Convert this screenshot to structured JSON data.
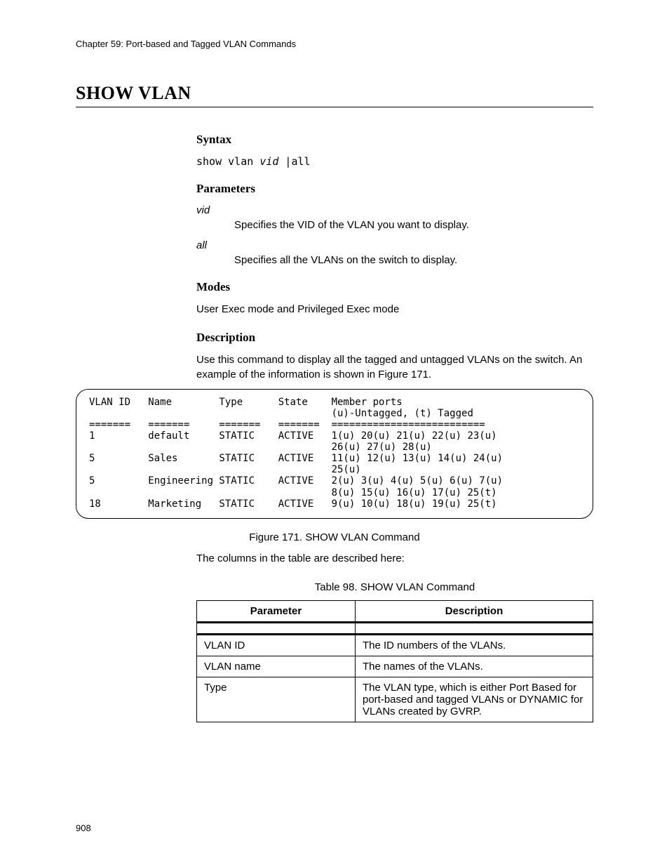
{
  "chapter_header": "Chapter 59: Port-based and Tagged VLAN Commands",
  "title": "SHOW VLAN",
  "sections": {
    "syntax": {
      "heading": "Syntax",
      "cmd_prefix": "show vlan ",
      "cmd_arg": "vid",
      "cmd_suffix": " |all"
    },
    "parameters": {
      "heading": "Parameters",
      "items": [
        {
          "term": "vid",
          "def": "Specifies the VID of the VLAN you want to display."
        },
        {
          "term": "all",
          "def": "Specifies all the VLANs on the switch to display."
        }
      ]
    },
    "modes": {
      "heading": "Modes",
      "text": "User Exec mode and Privileged Exec mode"
    },
    "description": {
      "heading": "Description",
      "text": "Use this command to display all the tagged and untagged VLANs on the switch. An example of the information is shown in Figure 171."
    }
  },
  "codebox": "VLAN ID   Name        Type      State    Member ports\n                                         (u)-Untagged, (t) Tagged\n=======   =======     =======   =======  ==========================\n1         default     STATIC    ACTIVE   1(u) 20(u) 21(u) 22(u) 23(u)\n                                         26(u) 27(u) 28(u)\n5         Sales       STATIC    ACTIVE   11(u) 12(u) 13(u) 14(u) 24(u)\n                                         25(u)\n5         Engineering STATIC    ACTIVE   2(u) 3(u) 4(u) 5(u) 6(u) 7(u)\n                                         8(u) 15(u) 16(u) 17(u) 25(t)\n18        Marketing   STATIC    ACTIVE   9(u) 10(u) 18(u) 19(u) 25(t)",
  "figure_caption": "Figure 171. SHOW VLAN Command",
  "post_fig_text": "The columns in the table are described here:",
  "table_caption": "Table 98. SHOW VLAN Command",
  "table": {
    "head": [
      "Parameter",
      "Description"
    ],
    "rows": [
      [
        "VLAN ID",
        "The ID numbers of the VLANs."
      ],
      [
        "VLAN name",
        "The names of the VLANs."
      ],
      [
        "Type",
        "The VLAN type, which is either Port Based for port-based and tagged VLANs or DYNAMIC for VLANs created by GVRP."
      ]
    ]
  },
  "page_number": "908"
}
